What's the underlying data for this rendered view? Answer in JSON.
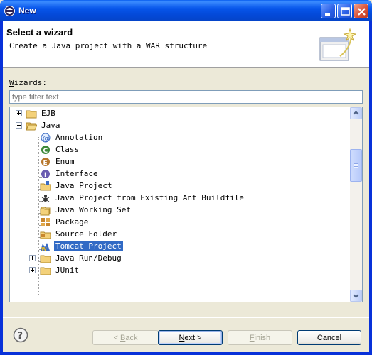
{
  "window": {
    "title": "New"
  },
  "banner": {
    "title": "Select a wizard",
    "description": "Create a Java project with a WAR structure"
  },
  "wizards_label": "Wizards:",
  "filter": {
    "placeholder": "type filter text",
    "value": ""
  },
  "tree": {
    "items": [
      {
        "label": "EJB",
        "icon": "folder-icon",
        "expanded": false,
        "depth": 0
      },
      {
        "label": "Java",
        "icon": "folder-open-icon",
        "expanded": true,
        "depth": 0
      },
      {
        "label": "Annotation",
        "icon": "annotation-icon",
        "depth": 1
      },
      {
        "label": "Class",
        "icon": "class-icon",
        "depth": 1
      },
      {
        "label": "Enum",
        "icon": "enum-icon",
        "depth": 1
      },
      {
        "label": "Interface",
        "icon": "interface-icon",
        "depth": 1
      },
      {
        "label": "Java Project",
        "icon": "java-project-icon",
        "depth": 1
      },
      {
        "label": "Java Project from Existing Ant Buildfile",
        "icon": "ant-icon",
        "depth": 1
      },
      {
        "label": "Java Working Set",
        "icon": "working-set-icon",
        "depth": 1
      },
      {
        "label": "Package",
        "icon": "package-icon",
        "depth": 1
      },
      {
        "label": "Source Folder",
        "icon": "source-folder-icon",
        "depth": 1
      },
      {
        "label": "Tomcat Project",
        "icon": "tomcat-icon",
        "depth": 1,
        "selected": true
      },
      {
        "label": "Java Run/Debug",
        "icon": "folder-icon",
        "expanded": false,
        "depth": 1
      },
      {
        "label": "JUnit",
        "icon": "folder-icon",
        "expanded": false,
        "depth": 1
      }
    ]
  },
  "buttons": {
    "back": {
      "label": "< Back",
      "mnemonic": "B",
      "enabled": false
    },
    "next": {
      "label": "Next >",
      "mnemonic": "N",
      "enabled": true
    },
    "finish": {
      "label": "Finish",
      "mnemonic": "F",
      "enabled": false
    },
    "cancel": {
      "label": "Cancel",
      "enabled": true
    }
  },
  "colors": {
    "selection": "#316ac5",
    "titlebar": "#0449d8",
    "background": "#ece9d8"
  }
}
